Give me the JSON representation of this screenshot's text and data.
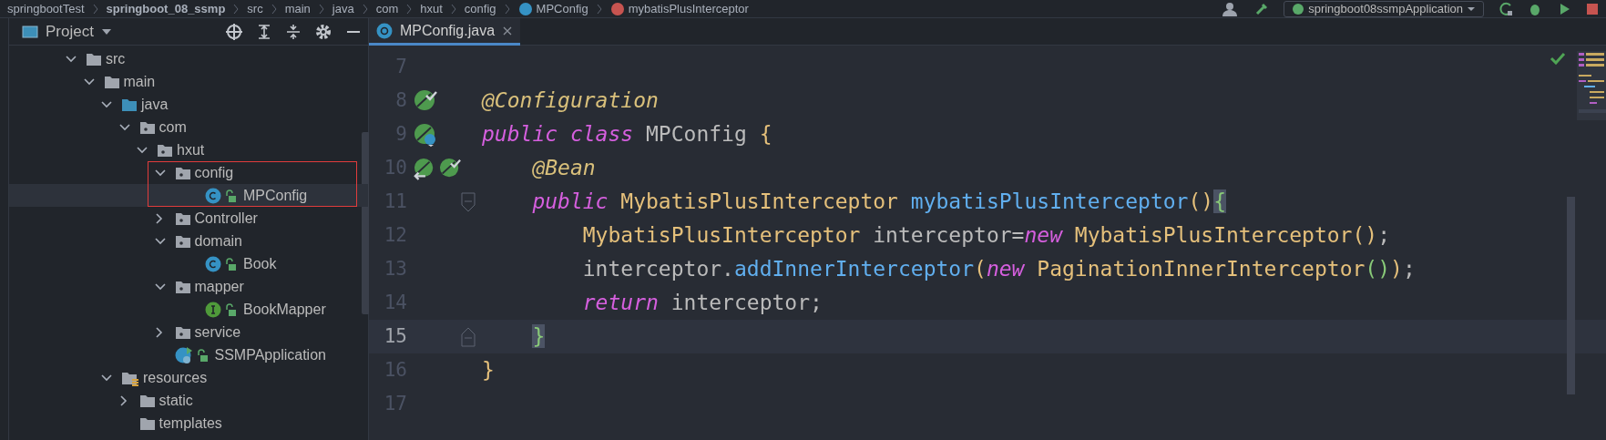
{
  "breadcrumbs": [
    {
      "label": "springbootTest",
      "kind": "module"
    },
    {
      "label": "springboot_08_ssmp",
      "kind": "project-root"
    },
    {
      "label": "src",
      "kind": "folder"
    },
    {
      "label": "main",
      "kind": "folder"
    },
    {
      "label": "java",
      "kind": "folder"
    },
    {
      "label": "com",
      "kind": "folder"
    },
    {
      "label": "hxut",
      "kind": "folder"
    },
    {
      "label": "config",
      "kind": "folder"
    },
    {
      "label": "MPConfig",
      "kind": "class"
    },
    {
      "label": "mybatisPlusInterceptor",
      "kind": "method"
    }
  ],
  "run_config": {
    "label": "springboot08ssmpApplication"
  },
  "project_panel": {
    "title": "Project",
    "tree": [
      {
        "label": "src",
        "kind": "folder",
        "expanded": true,
        "selected": false,
        "children": [
          {
            "label": "main",
            "kind": "folder",
            "expanded": true,
            "selected": false,
            "children": [
              {
                "label": "java",
                "kind": "source-folder",
                "expanded": true,
                "selected": false,
                "children": [
                  {
                    "label": "com",
                    "kind": "package",
                    "expanded": true,
                    "selected": false,
                    "children": [
                      {
                        "label": "hxut",
                        "kind": "package",
                        "expanded": true,
                        "selected": false,
                        "children": [
                          {
                            "label": "config",
                            "kind": "package",
                            "expanded": true,
                            "selected": false,
                            "boxed": true,
                            "children": [
                              {
                                "label": "MPConfig",
                                "kind": "class",
                                "selected": true
                              }
                            ]
                          },
                          {
                            "label": "Controller",
                            "kind": "package",
                            "expanded": false,
                            "selected": false
                          },
                          {
                            "label": "domain",
                            "kind": "package",
                            "expanded": true,
                            "selected": false,
                            "children": [
                              {
                                "label": "Book",
                                "kind": "class",
                                "selected": false
                              }
                            ]
                          },
                          {
                            "label": "mapper",
                            "kind": "package",
                            "expanded": true,
                            "selected": false,
                            "children": [
                              {
                                "label": "BookMapper",
                                "kind": "interface",
                                "selected": false
                              }
                            ]
                          },
                          {
                            "label": "service",
                            "kind": "package",
                            "expanded": false,
                            "selected": false
                          },
                          {
                            "label": "SSMPApplication",
                            "kind": "app-class",
                            "selected": false
                          }
                        ]
                      }
                    ]
                  }
                ]
              },
              {
                "label": "resources",
                "kind": "resource-folder",
                "expanded": true,
                "selected": false,
                "children": [
                  {
                    "label": "static",
                    "kind": "folder",
                    "expanded": false,
                    "selected": false
                  },
                  {
                    "label": "templates",
                    "kind": "folder",
                    "selected": false
                  }
                ]
              }
            ]
          }
        ]
      }
    ]
  },
  "editor": {
    "tabs": [
      {
        "label": "MPConfig.java",
        "selected": true
      }
    ],
    "lines": [
      {
        "number": "7",
        "current": false
      },
      {
        "number": "8",
        "current": false,
        "gutter": [
          {
            "kind": "bean"
          }
        ],
        "tokens": [
          {
            "text": "@Configuration",
            "kind": "annotation"
          }
        ]
      },
      {
        "number": "9",
        "current": false,
        "gutter": [
          {
            "kind": "bean-class"
          }
        ],
        "tokens": [
          {
            "text": "public class ",
            "kind": "keyword"
          },
          {
            "text": "MPConfig ",
            "kind": "plain"
          },
          {
            "text": "{",
            "kind": "bracket-1"
          }
        ]
      },
      {
        "number": "10",
        "current": false,
        "gutter": [
          {
            "kind": "bean-navigate"
          },
          {
            "kind": "bean"
          }
        ],
        "tokens": [
          {
            "text": "    @Bean",
            "kind": "annotation"
          }
        ]
      },
      {
        "number": "11",
        "current": false,
        "fold_start": true,
        "tokens": [
          {
            "text": "    public ",
            "kind": "keyword"
          },
          {
            "text": "MybatisPlusInterceptor ",
            "kind": "type"
          },
          {
            "text": "mybatisPlusInterceptor",
            "kind": "method"
          },
          {
            "text": "()",
            "kind": "bracket-1"
          },
          {
            "text": "{",
            "kind": "bracket-2",
            "matched": true
          }
        ]
      },
      {
        "number": "12",
        "current": false,
        "tokens": [
          {
            "text": "        MybatisPlusInterceptor ",
            "kind": "type"
          },
          {
            "text": "interceptor=",
            "kind": "plain"
          },
          {
            "text": "new ",
            "kind": "keyword"
          },
          {
            "text": "MybatisPlusInterceptor",
            "kind": "type"
          },
          {
            "text": "()",
            "kind": "bracket-1"
          },
          {
            "text": ";",
            "kind": "plain"
          }
        ]
      },
      {
        "number": "13",
        "current": false,
        "tokens": [
          {
            "text": "        interceptor.",
            "kind": "plain"
          },
          {
            "text": "addInnerInterceptor",
            "kind": "method"
          },
          {
            "text": "(",
            "kind": "bracket-1"
          },
          {
            "text": "new ",
            "kind": "keyword"
          },
          {
            "text": "PaginationInnerInterceptor",
            "kind": "type"
          },
          {
            "text": "()",
            "kind": "bracket-2"
          },
          {
            "text": ")",
            "kind": "bracket-1"
          },
          {
            "text": ";",
            "kind": "plain"
          }
        ]
      },
      {
        "number": "14",
        "current": false,
        "tokens": [
          {
            "text": "        return ",
            "kind": "keyword"
          },
          {
            "text": "interceptor;",
            "kind": "plain"
          }
        ]
      },
      {
        "number": "15",
        "current": true,
        "fold_end": true,
        "tokens": [
          {
            "text": "    }",
            "kind": "bracket-2",
            "matched": true
          }
        ]
      },
      {
        "number": "16",
        "current": false,
        "tokens": [
          {
            "text": "}",
            "kind": "bracket-1"
          }
        ]
      },
      {
        "number": "17",
        "current": false
      }
    ]
  }
}
